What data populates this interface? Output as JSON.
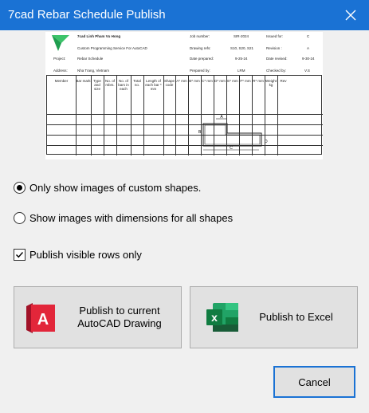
{
  "window": {
    "title": "7cad Rebar Schedule Publish",
    "accent": "#1a72d4"
  },
  "preview": {
    "company": "7cad Linh Pham Vu Hong",
    "service": "Custom Programming Service For AutoCAD",
    "project_label": "Project:",
    "project_value": "Rebar Schedule",
    "address_label": "Address:",
    "address_value": "Nha Trang, Vietnam",
    "job_number_label": "Job number:",
    "job_number_value": "SIR-2024",
    "issued_for_label": "Issued for:",
    "issued_for_value": "C",
    "drawing_refs_label": "Drawing refs:",
    "drawing_refs_value": "S10, S20, S21",
    "revision_label": "Revision :",
    "revision_value": "A",
    "date_prepared_label": "Date prepared:",
    "date_prepared_value": "9-25-24",
    "date_revised_label": "Date revised:",
    "date_revised_value": "9-30-24",
    "prepared_by_label": "Prepared by:",
    "prepared_by_value": "LRM",
    "checked_by_label": "Checked by:",
    "checked_by_value": "V.S",
    "columns": [
      "Member",
      "Bar mark",
      "Type and size",
      "No. of mbrs.",
      "No. of bars in each",
      "Total no.",
      "Length of each bar * mm",
      "Shape code",
      "A* mm",
      "B* mm",
      "C* mm",
      "D* mm",
      "E* mm",
      "F* mm",
      "R* mm",
      "Weight kg",
      "Rev"
    ],
    "shape_labels": {
      "a": "A",
      "b": "B",
      "c": "C",
      "d": "D"
    }
  },
  "options": {
    "custom_shapes_label": "Only show images of custom shapes.",
    "custom_shapes_selected": true,
    "all_shapes_label": "Show images with dimensions for all shapes",
    "all_shapes_selected": false,
    "visible_rows_label": "Publish visible rows only",
    "visible_rows_checked": true
  },
  "buttons": {
    "publish_autocad_line1": "Publish to current",
    "publish_autocad_line2": "AutoCAD Drawing",
    "autocad_icon_letter": "A",
    "publish_excel": "Publish to Excel",
    "excel_icon_letter": "x",
    "cancel": "Cancel"
  }
}
